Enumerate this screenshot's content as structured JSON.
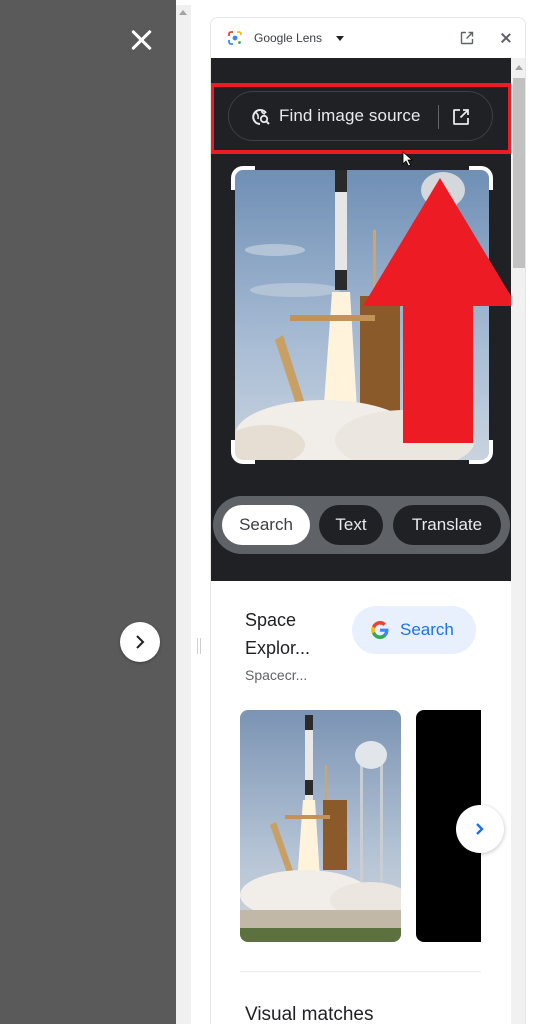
{
  "overlay": {
    "close_icon": "close-icon",
    "next_icon": "chevron-right-icon"
  },
  "panel": {
    "title": "Google Lens",
    "icons": {
      "logo": "google-lens-icon",
      "dropdown": "caret-down-icon",
      "open_new_tab": "open-in-new-icon",
      "close": "close-icon"
    },
    "find_source": {
      "label": "Find image source",
      "icon": "image-search-icon",
      "open_icon": "open-in-new-icon"
    },
    "modes": [
      {
        "label": "Search",
        "active": true
      },
      {
        "label": "Text",
        "active": false
      },
      {
        "label": "Translate",
        "active": false
      }
    ],
    "result": {
      "title_line1": "Space",
      "title_line2": "Explor...",
      "subtitle": "Spacecr...",
      "search_button": "Search",
      "search_icon": "google-g-icon"
    },
    "carousel_next_icon": "chevron-right-icon",
    "section_heading": "Visual matches"
  },
  "annotation": {
    "highlight_color": "#ed1c24",
    "arrow_color": "#ed1c24"
  },
  "colors": {
    "dark_bg": "#202124",
    "accent_blue": "#1a73e8",
    "chip_bg": "#e8f0fe"
  }
}
